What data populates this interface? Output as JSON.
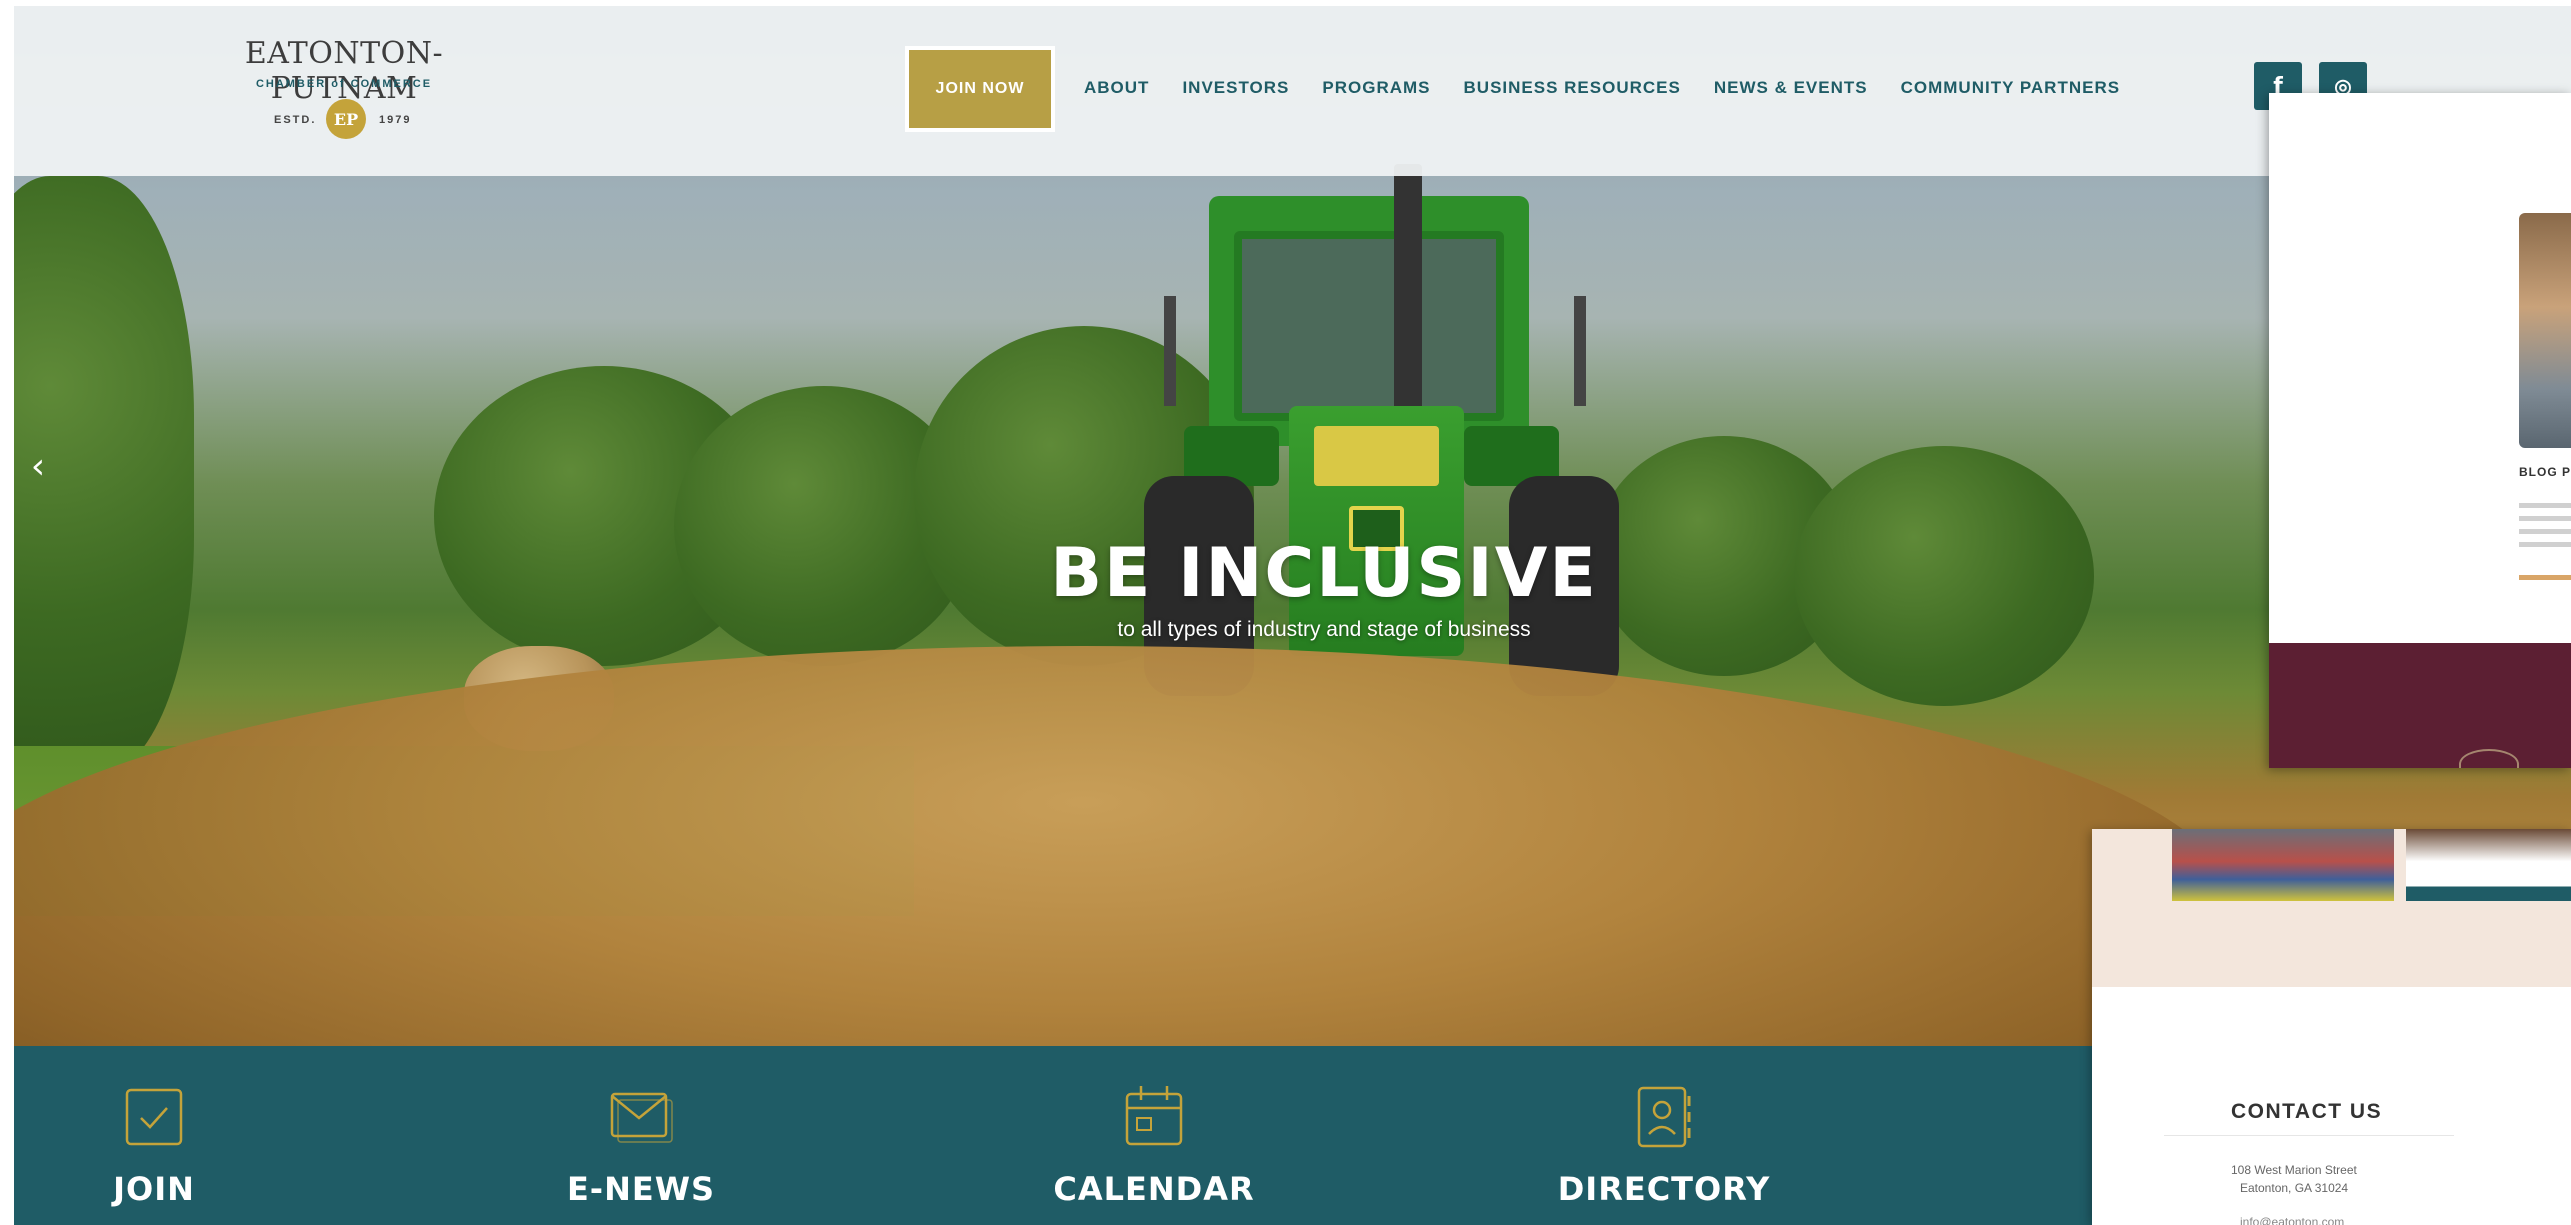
{
  "brand": {
    "name": "EATONTON-PUTNAM",
    "tagline": "CHAMBER of COMMERCE",
    "estd_label": "ESTD.",
    "estd_year": "1979"
  },
  "header": {
    "join_label": "JOIN NOW",
    "nav": [
      "ABOUT",
      "INVESTORS",
      "PROGRAMS",
      "BUSINESS RESOURCES",
      "NEWS & EVENTS",
      "COMMUNITY PARTNERS"
    ],
    "social": {
      "facebook": "f",
      "instagram": "◎"
    }
  },
  "hero": {
    "title": "BE INCLUSIVE",
    "subtitle": "to all types of industry and stage of business",
    "prev_arrow": "‹"
  },
  "quick_links": [
    {
      "label": "JOIN",
      "icon": "check-icon"
    },
    {
      "label": "E-NEWS",
      "icon": "envelope-icon"
    },
    {
      "label": "CALENDAR",
      "icon": "calendar-icon"
    },
    {
      "label": "DIRECTORY",
      "icon": "contact-book-icon"
    }
  ],
  "overlay_blog": {
    "title": "BLOG P"
  },
  "overlay_contact": {
    "heading": "CONTACT US",
    "street": "108 West Marion Street",
    "city": "Eatonton, GA 31024",
    "email": "info@eatonton.com"
  },
  "colors": {
    "teal": "#1f5c66",
    "gold": "#b79f45",
    "maroon": "#5c1f33",
    "cream": "#f3e6dc"
  }
}
